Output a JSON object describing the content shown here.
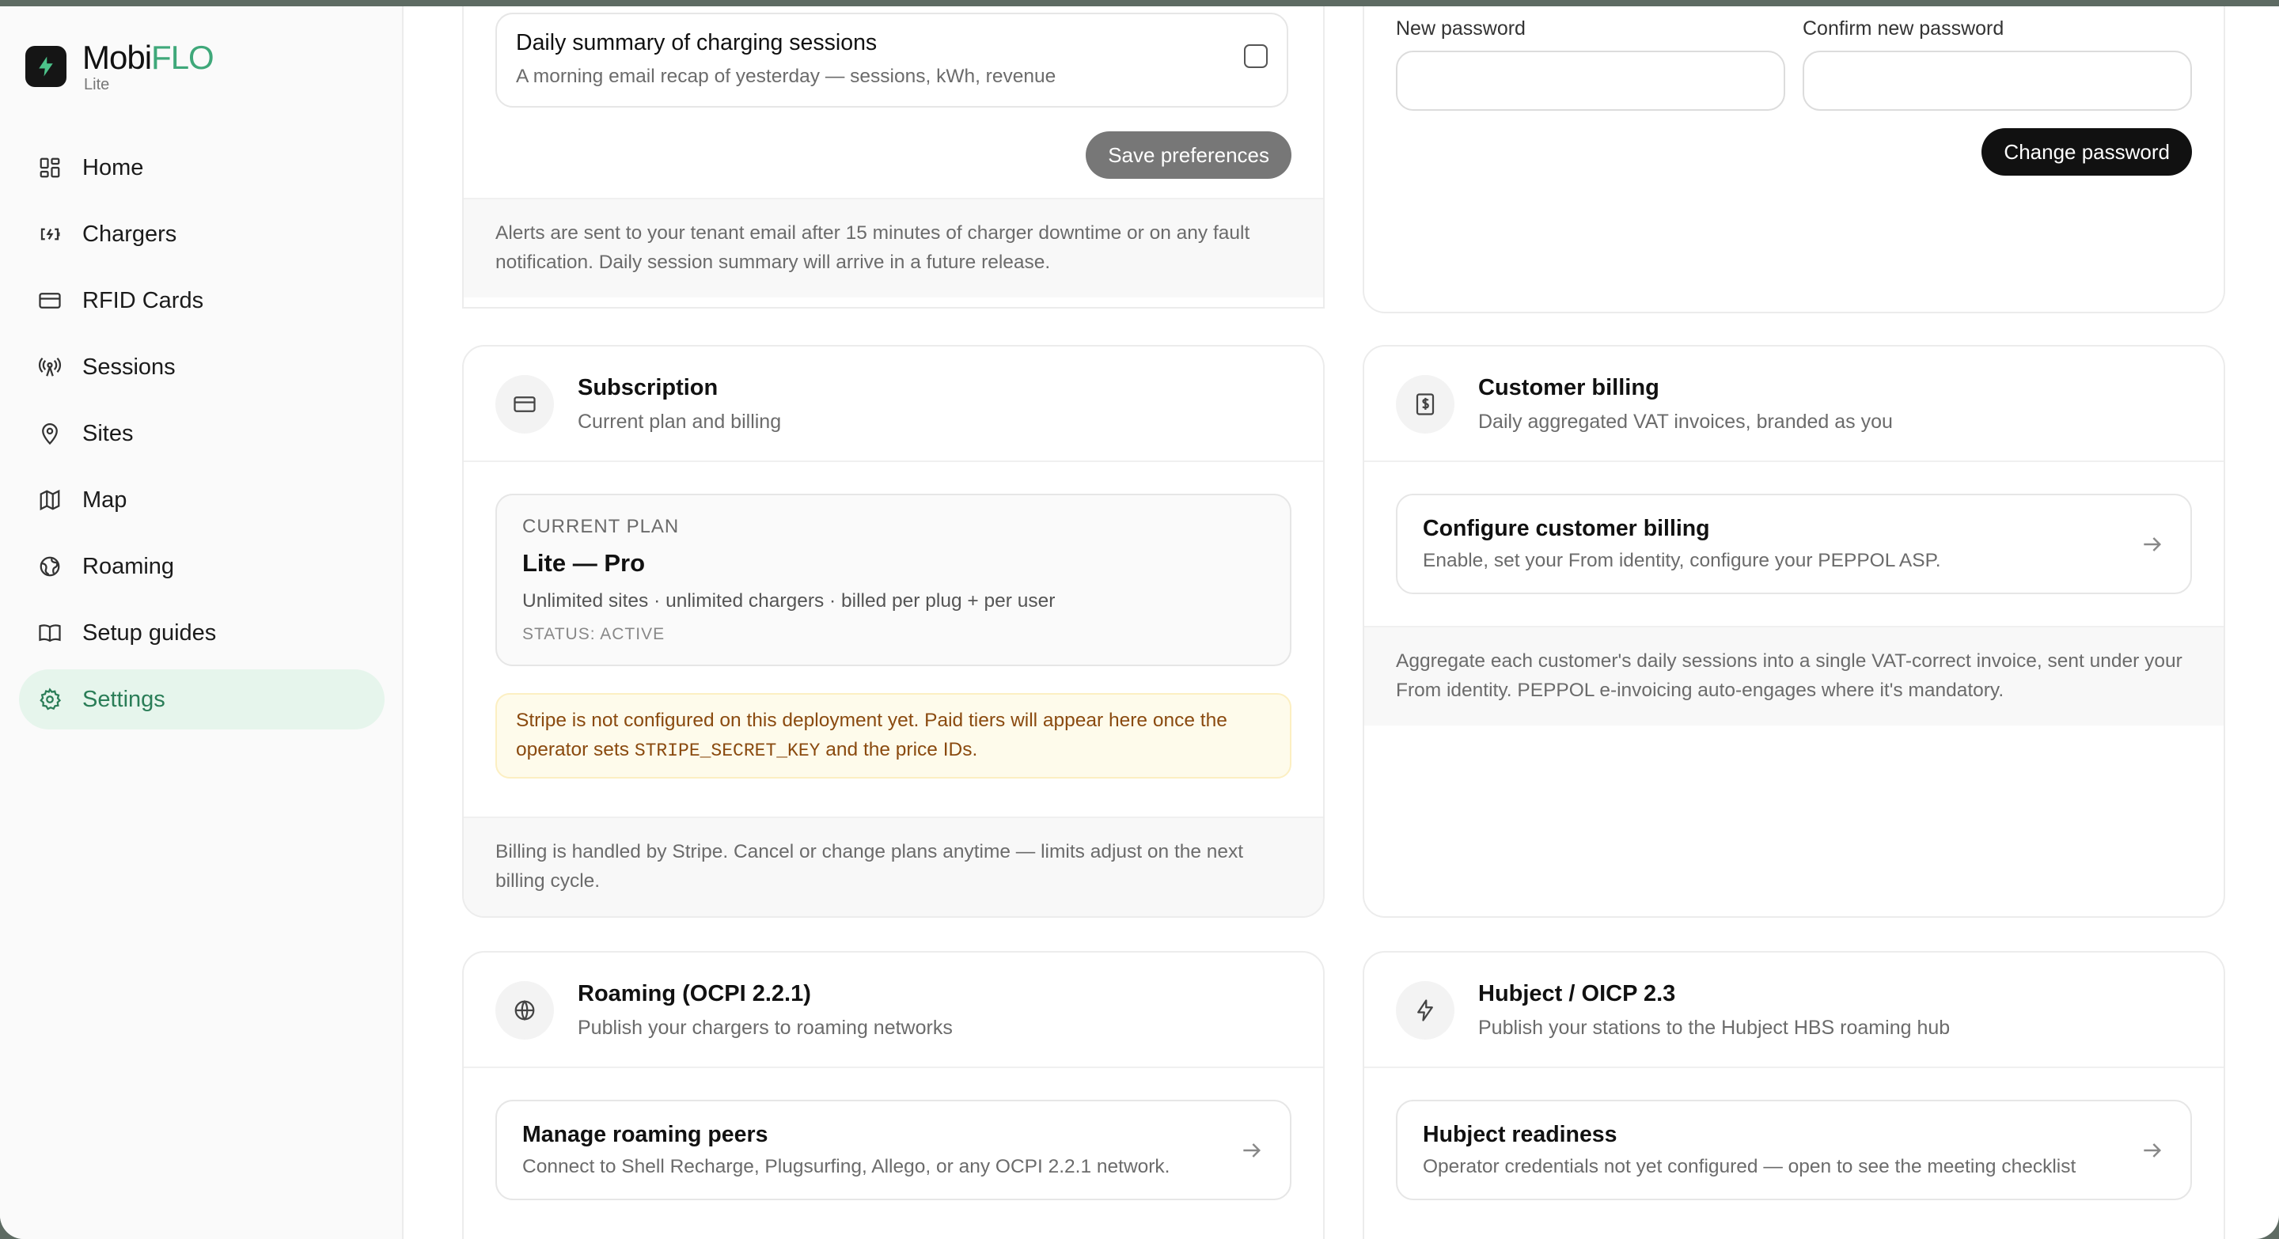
{
  "brand": {
    "name_prefix": "Mobi",
    "name_accent": "FLO",
    "tier": "Lite"
  },
  "nav": [
    {
      "label": "Home",
      "icon": "grid-icon"
    },
    {
      "label": "Chargers",
      "icon": "plug-icon"
    },
    {
      "label": "RFID Cards",
      "icon": "card-icon"
    },
    {
      "label": "Sessions",
      "icon": "broadcast-icon"
    },
    {
      "label": "Sites",
      "icon": "map-pin-icon"
    },
    {
      "label": "Map",
      "icon": "map-icon"
    },
    {
      "label": "Roaming",
      "icon": "globe-icon"
    },
    {
      "label": "Setup guides",
      "icon": "book-icon"
    },
    {
      "label": "Settings",
      "icon": "gear-icon",
      "active": true
    }
  ],
  "notifications": {
    "summary_title": "Daily summary of charging sessions",
    "summary_desc": "A morning email recap of yesterday — sessions, kWh, revenue",
    "summary_checked": false,
    "save_label": "Save preferences",
    "note": "Alerts are sent to your tenant email after 15 minutes of charger downtime or on any fault notification. Daily session summary will arrive in a future release."
  },
  "password": {
    "new_label": "New password",
    "confirm_label": "Confirm new password",
    "new_value": "",
    "confirm_value": "",
    "button_label": "Change password"
  },
  "subscription": {
    "title": "Subscription",
    "subtitle": "Current plan and billing",
    "plan_eyebrow": "CURRENT PLAN",
    "plan_name": "Lite — Pro",
    "plan_desc": "Unlimited sites · unlimited chargers · billed per plug + per user",
    "plan_status": "STATUS: ACTIVE",
    "warn_before": "Stripe is not configured on this deployment yet. Paid tiers will appear here once the operator sets ",
    "warn_code": "STRIPE_SECRET_KEY",
    "warn_after": " and the price IDs.",
    "note": "Billing is handled by Stripe. Cancel or change plans anytime — limits adjust on the next billing cycle."
  },
  "customer_billing": {
    "title": "Customer billing",
    "subtitle": "Daily aggregated VAT invoices, branded as you",
    "link_title": "Configure customer billing",
    "link_desc": "Enable, set your From identity, configure your PEPPOL ASP.",
    "note": "Aggregate each customer's daily sessions into a single VAT-correct invoice, sent under your From identity. PEPPOL e-invoicing auto-engages where it's mandatory."
  },
  "roaming": {
    "title": "Roaming (OCPI 2.2.1)",
    "subtitle": "Publish your chargers to roaming networks",
    "link_title": "Manage roaming peers",
    "link_desc": "Connect to Shell Recharge, Plugsurfing, Allego, or any OCPI 2.2.1 network."
  },
  "hubject": {
    "title": "Hubject / OICP 2.3",
    "subtitle": "Publish your stations to the Hubject HBS roaming hub",
    "link_title": "Hubject readiness",
    "link_desc": "Operator credentials not yet configured — open to see the meeting checklist"
  }
}
